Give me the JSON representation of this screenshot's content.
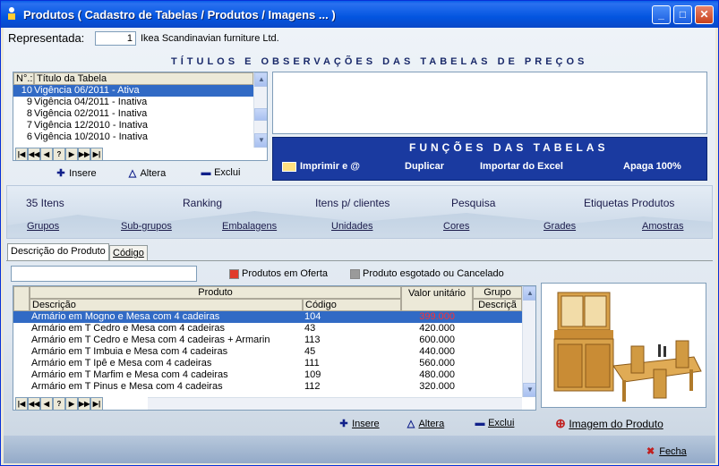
{
  "window": {
    "title": "Produtos ( Cadastro de Tabelas / Produtos / Imagens ... )",
    "min_glyph": "_",
    "max_glyph": "□",
    "close_glyph": "✕"
  },
  "header": {
    "representada_label": "Representada:",
    "representada_code": "1",
    "representada_name": "Ikea Scandinavian furniture Ltd."
  },
  "titles_section": {
    "banner": "TÍTULOS E OBSERVAÇÕES DAS TABELAS DE PREÇOS",
    "col_num": "N°.:",
    "col_title": "Título da Tabela",
    "rows": [
      {
        "num": "10",
        "title": "Vigência 06/2011 - Ativa",
        "selected": true
      },
      {
        "num": "9",
        "title": "Vigência 04/2011 - Inativa",
        "selected": false
      },
      {
        "num": "8",
        "title": "Vigência 02/2011 - Inativa",
        "selected": false
      },
      {
        "num": "7",
        "title": "Vigência 12/2010 - Inativa",
        "selected": false
      },
      {
        "num": "6",
        "title": "Vigência 10/2010 - Inativa",
        "selected": false
      }
    ],
    "actions": {
      "insere": "Insere",
      "altera": "Altera",
      "exclui": "Exclui"
    }
  },
  "functions_panel": {
    "title": "FUNÇÕES DAS TABELAS",
    "items": [
      "Imprimir e @",
      "Duplicar",
      "Importar do Excel",
      "Apaga 100%"
    ]
  },
  "menu": {
    "row1": [
      "35 Itens",
      "Ranking",
      "Itens p/ clientes",
      "Pesquisa",
      "Etiquetas Produtos"
    ],
    "row2": [
      "Grupos",
      "Sub-grupos",
      "Embalagens",
      "Unidades",
      "Cores",
      "Grades",
      "Amostras"
    ]
  },
  "tabs": [
    "Descrição do Produto",
    "Código"
  ],
  "filters": {
    "search_value": "",
    "offer_label": "Produtos em Oferta",
    "offer_color": "#e03a2a",
    "sold_out_label": "Produto esgotado ou Cancelado",
    "sold_out_color": "#9a9a9a"
  },
  "products_grid": {
    "group_header": "Produto",
    "col_desc": "Descrição",
    "col_code": "Código",
    "col_price": "Valor unitário",
    "col_group": "Grupo",
    "col_group_desc": "Descriçã",
    "rows": [
      {
        "desc": "Armário em Mogno e Mesa com 4 cadeiras",
        "code": "104",
        "price": "399.000",
        "selected": true
      },
      {
        "desc": "Armário em T Cedro e Mesa com 4 cadeiras",
        "code": "43",
        "price": "420.000",
        "selected": false
      },
      {
        "desc": "Armário em T Cedro e Mesa com 4 cadeiras + Armarin",
        "code": "113",
        "price": "600.000",
        "selected": false
      },
      {
        "desc": "Armário em T Imbuia e Mesa com 4 cadeiras",
        "code": "45",
        "price": "440.000",
        "selected": false
      },
      {
        "desc": "Armário em T Ipê e Mesa com 4 cadeiras",
        "code": "111",
        "price": "560.000",
        "selected": false
      },
      {
        "desc": "Armário em T Marfim e Mesa com 4 cadeiras",
        "code": "109",
        "price": "480.000",
        "selected": false
      },
      {
        "desc": "Armário em T Pinus e Mesa com 4 cadeiras",
        "code": "112",
        "price": "320.000",
        "selected": false
      }
    ],
    "actions": {
      "insere": "Insere",
      "altera": "Altera",
      "exclui": "Exclui",
      "imagem": "Imagem do Produto"
    }
  },
  "footer": {
    "fecha": "Fecha"
  },
  "nav_glyphs": [
    "|◀",
    "◀◀",
    "◀",
    "?",
    "▶",
    "▶▶",
    "▶|"
  ]
}
